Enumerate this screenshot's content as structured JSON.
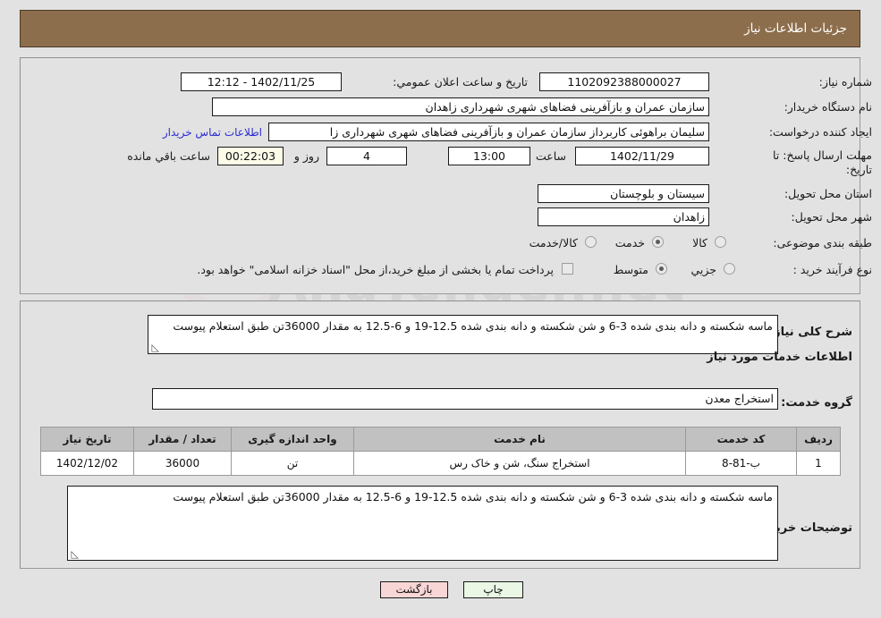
{
  "header": {
    "title": "جزئیات اطلاعات نیاز"
  },
  "top_form": {
    "need_number_label": "شماره نیاز:",
    "need_number_value": "1102092388000027",
    "announce_datetime_label": "تاریخ و ساعت اعلان عمومي:",
    "announce_datetime_value": "1402/11/25 - 12:12",
    "buyer_org_label": "نام دستگاه خریدار:",
    "buyer_org_value": "سازمان عمران و بازآفرینی فضاهای شهری شهرداری زاهدان",
    "requester_label": "ایجاد کننده درخواست:",
    "requester_value": "سلیمان براهوئی کاربرداز سازمان عمران و بازآفرینی فضاهای شهری شهرداری زا",
    "buyer_contact_link": "اطلاعات تماس خریدار",
    "deadline_label_line1": "مهلت ارسال پاسخ: تا",
    "deadline_label_line2": "تاریخ:",
    "deadline_date_value": "1402/11/29",
    "hour_label": "ساعت",
    "hour_value": "13:00",
    "days_value": "4",
    "days_label": "روز و",
    "countdown_value": "00:22:03",
    "countdown_label": "ساعت باقي مانده",
    "province_label": "استان محل تحویل:",
    "province_value": "سیستان و بلوچستان",
    "city_label": "شهر محل تحویل:",
    "city_value": "زاهدان",
    "category_label": "طبقه بندی موضوعی:",
    "category_options": [
      {
        "label": "کالا",
        "selected": false
      },
      {
        "label": "خدمت",
        "selected": true
      },
      {
        "label": "کالا/خدمت",
        "selected": false
      }
    ],
    "process_label": "نوع فرآیند خرید :",
    "process_options": [
      {
        "label": "جزیي",
        "selected": false
      },
      {
        "label": "متوسط",
        "selected": true
      }
    ],
    "treasury_note": "پرداخت تمام یا بخشی از مبلغ خرید،از محل \"اسناد خزانه اسلامی\" خواهد بود."
  },
  "bottom_form": {
    "overall_desc_label": "شرح کلی نیاز:",
    "overall_desc_value": "ماسه شکسته و دانه بندی شده 3-6 و شن شکسته و دانه بندی شده 12.5-19 و 6-12.5 به مقدار 36000تن طبق استعلام پیوست",
    "services_section_title": "اطلاعات خدمات مورد نیاز",
    "service_group_label": "گروه خدمت:",
    "service_group_value": "استخراج معدن",
    "buyer_notes_label": "توضیحات خریدار:",
    "buyer_notes_value": "ماسه شکسته و دانه بندی شده 3-6 و شن شکسته و دانه بندی شده 12.5-19 و 6-12.5 به مقدار 36000تن طبق استعلام پیوست"
  },
  "table": {
    "headers": [
      "ردیف",
      "کد خدمت",
      "نام خدمت",
      "واحد اندازه گیری",
      "تعداد / مقدار",
      "تاریخ نیاز"
    ],
    "rows": [
      {
        "row_no": "1",
        "service_code": "ب-81-8",
        "service_name": "استخراج سنگ، شن و خاک رس",
        "unit": "تن",
        "quantity": "36000",
        "need_date": "1402/12/02"
      }
    ]
  },
  "buttons": {
    "back": "بازگشت",
    "print": "چاپ"
  },
  "colors": {
    "header_bg": "#8d6e4c",
    "page_bg": "#e2e2e2",
    "link": "#2b2bd6",
    "back_btn_bg": "#f9d6d6",
    "print_btn_bg": "#e9f7e4",
    "table_header_bg": "#c1c1c1",
    "countdown_bg": "#fbfbe8"
  },
  "watermark": {
    "text": "AnaTender.net"
  }
}
